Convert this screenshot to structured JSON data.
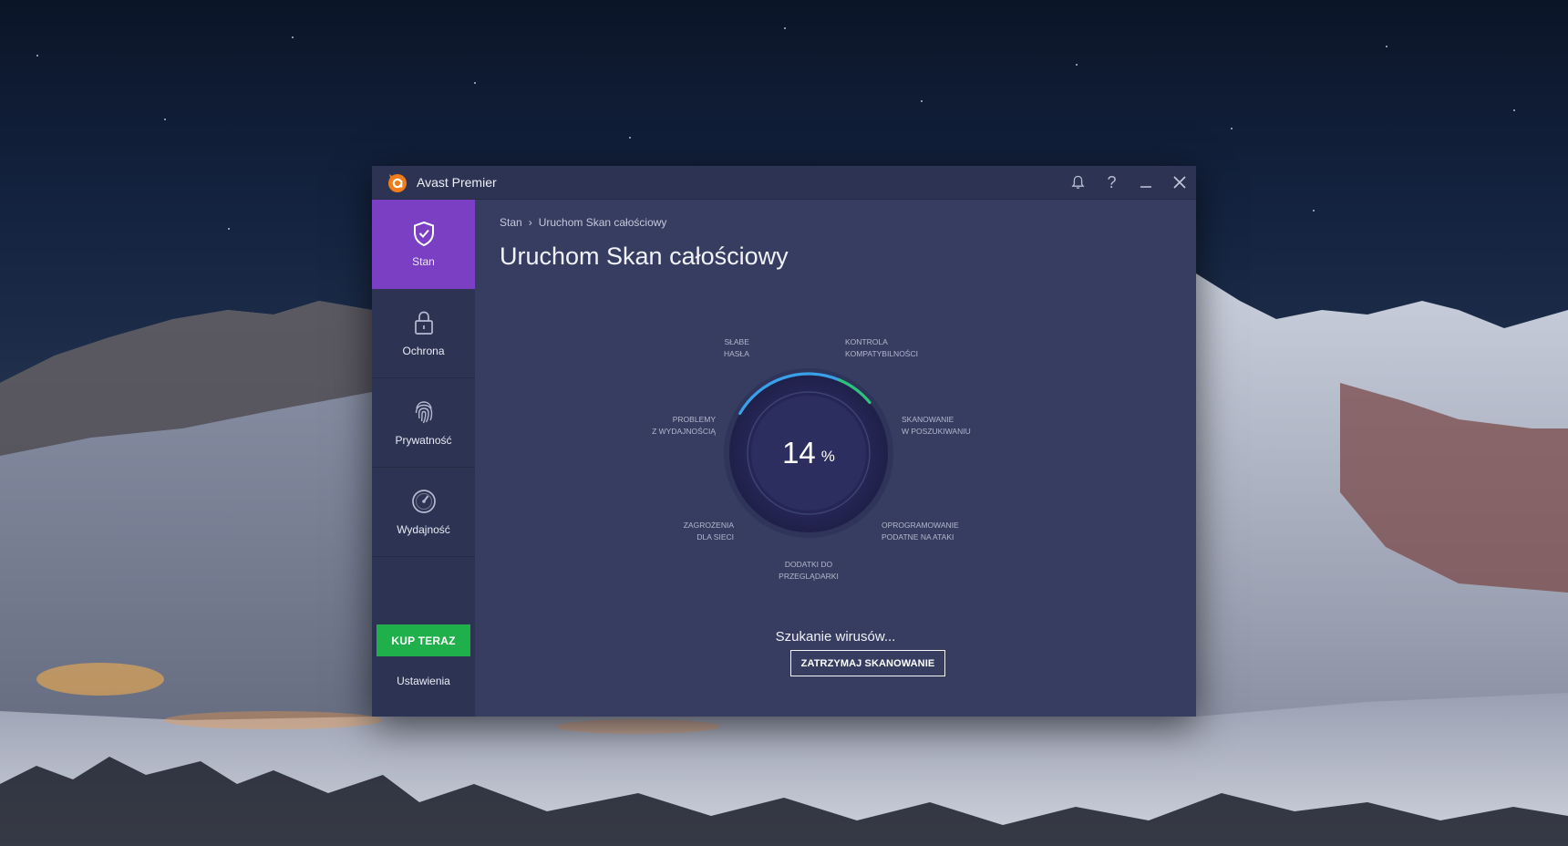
{
  "window": {
    "title": "Avast Premier",
    "controls": {
      "notifications_icon": "bell-icon",
      "help_label": "?",
      "minimize_icon": "minimize-icon",
      "close_icon": "close-icon"
    }
  },
  "sidebar": {
    "items": [
      {
        "label": "Stan",
        "icon": "shield-check-icon",
        "active": true
      },
      {
        "label": "Ochrona",
        "icon": "lock-icon",
        "active": false
      },
      {
        "label": "Prywatność",
        "icon": "fingerprint-icon",
        "active": false
      },
      {
        "label": "Wydajność",
        "icon": "speedometer-icon",
        "active": false
      }
    ],
    "buy_label": "KUP TERAZ",
    "settings_label": "Ustawienia"
  },
  "main": {
    "breadcrumb": {
      "root": "Stan",
      "separator": "›",
      "current": "Uruchom Skan całościowy"
    },
    "title": "Uruchom Skan całościowy",
    "progress": {
      "value": "14",
      "unit": "%",
      "fraction": 0.14
    },
    "scan_categories": [
      {
        "line1": "SŁABE",
        "line2": "HASŁA"
      },
      {
        "line1": "KONTROLA",
        "line2": "KOMPATYBILNOŚCI"
      },
      {
        "line1": "SKANOWANIE",
        "line2": "W POSZUKIWANIU"
      },
      {
        "line1": "OPROGRAMOWANIE",
        "line2": "PODATNE NA ATAKI"
      },
      {
        "line1": "DODATKI DO",
        "line2": "PRZEGLĄDARKI"
      },
      {
        "line1": "ZAGROŻENIA",
        "line2": "DLA SIECI"
      },
      {
        "line1": "PROBLEMY",
        "line2": "Z WYDAJNOŚCIĄ"
      }
    ],
    "status_text": "Szukanie wirusów...",
    "stop_button_label": "ZATRZYMAJ SKANOWANIE"
  },
  "colors": {
    "accent_purple": "#7b3fc4",
    "buy_green": "#20b04b",
    "progress_green": "#2ec27e",
    "progress_blue": "#3aa0e8",
    "logo_orange": "#f07d1a"
  }
}
